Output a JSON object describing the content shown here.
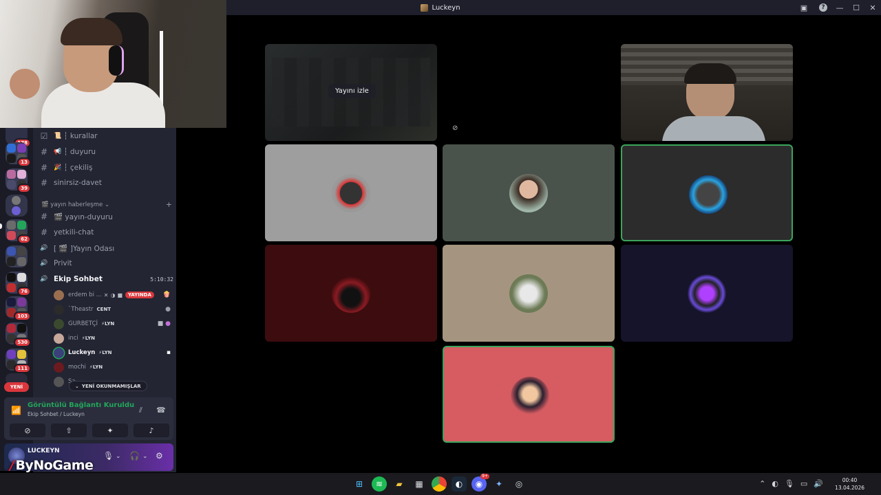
{
  "window": {
    "title": "Luckeyn"
  },
  "rail": {
    "badges": [
      "178",
      "13",
      "39",
      "62",
      "76",
      "103",
      "530",
      "111"
    ],
    "new_label": "YENİ"
  },
  "channels": [
    {
      "icon": "☑",
      "emoji": "📜",
      "label": "┆ kurallar"
    },
    {
      "icon": "#",
      "emoji": "📢",
      "label": "┆ duyuru"
    },
    {
      "icon": "#",
      "emoji": "🎉",
      "label": "┆ çekiliş"
    },
    {
      "icon": "#",
      "emoji": "",
      "label": "sinirsiz-davet"
    }
  ],
  "category": {
    "label": "🎬 yayın haberleşme ⌄",
    "add": "+"
  },
  "channels2": [
    {
      "icon": "#",
      "label": "🎬 yayın-duyuru"
    },
    {
      "icon": "#",
      "label": "yetkili-chat"
    },
    {
      "icon": "🔊",
      "label": "[ 🎬 ]Yayın Odası"
    },
    {
      "icon": "🔊",
      "label": "Privit"
    }
  ],
  "active_channel": {
    "icon": "🔊",
    "label": "Ekip Sohbet",
    "timer": "5:10:32"
  },
  "voice_users": [
    {
      "name": "erdem bi ...",
      "tag": "",
      "live": "YAYINDA",
      "color": "#9a6f4f"
    },
    {
      "name": "`Theastr",
      "tag": "CENT",
      "color": "#2b2b2b"
    },
    {
      "name": "GURBETÇİ",
      "tag": "⚡LYN",
      "color": "#3b4a2e"
    },
    {
      "name": "inci",
      "tag": "⚡LYN",
      "color": "#c7a89a"
    },
    {
      "name": "Luckeyn",
      "tag": "⚡LYN",
      "color": "#3b3f7a"
    },
    {
      "name": "mochi",
      "tag": "⚡LYN",
      "color": "#6b1b1f"
    },
    {
      "name": "Sa...",
      "tag": "",
      "color": "#555"
    }
  ],
  "unread_label": "YENİ OKUNMAMIŞLAR",
  "voice_panel": {
    "title": "Görüntülü Bağlantı Kuruldu",
    "subtitle": "Ekip Sohbet / Luckeyn"
  },
  "user_panel": {
    "name": "LUCKEYN"
  },
  "watermark": {
    "brand": "ByNoGame"
  },
  "call": {
    "watch_stream_label": "Yayını izle"
  },
  "taskbar": {
    "time": "00:40",
    "date": "13.04.2026",
    "discord_badge": "9+"
  },
  "colors": {
    "accent_green": "#3ba55c",
    "danger": "#da373c",
    "tile_bg": [
      "#9e9e9e",
      "#4a524c",
      "#2c2c2c",
      "#3d0c0e",
      "#a59580",
      "#15142a",
      "#d65c62"
    ]
  }
}
